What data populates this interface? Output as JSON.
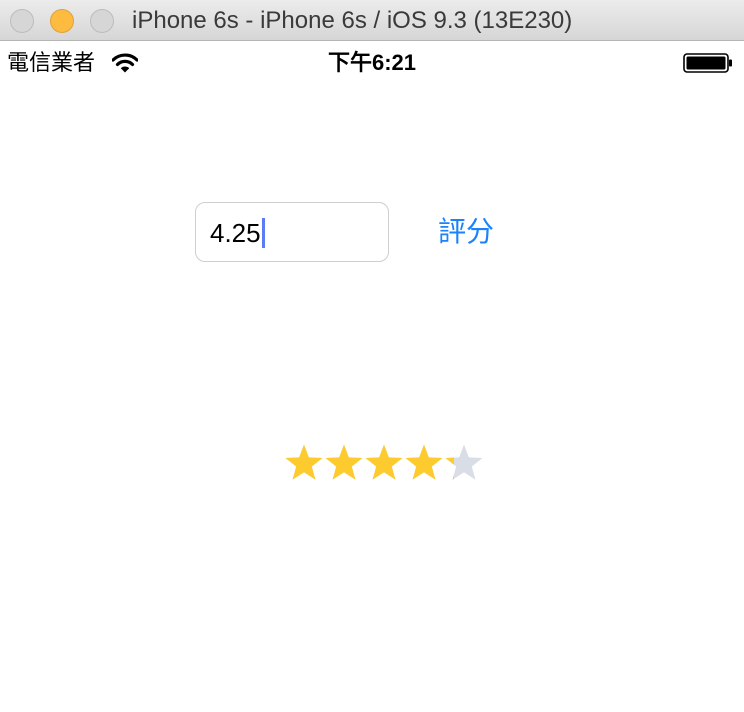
{
  "window": {
    "title": "iPhone 6s - iPhone 6s / iOS 9.3 (13E230)"
  },
  "status_bar": {
    "carrier": "電信業者",
    "time": "下午6:21",
    "icons": [
      "wifi-icon",
      "battery-icon"
    ]
  },
  "rating_input": {
    "value": "4.25"
  },
  "rate_button": {
    "label": "評分"
  },
  "star_rating": {
    "value": 4.25,
    "max": 5,
    "filled_color": "#fdcb2e",
    "empty_color": "#d8dde6"
  },
  "colors": {
    "accent": "#1a82fb",
    "caret": "#5b7cf5"
  }
}
